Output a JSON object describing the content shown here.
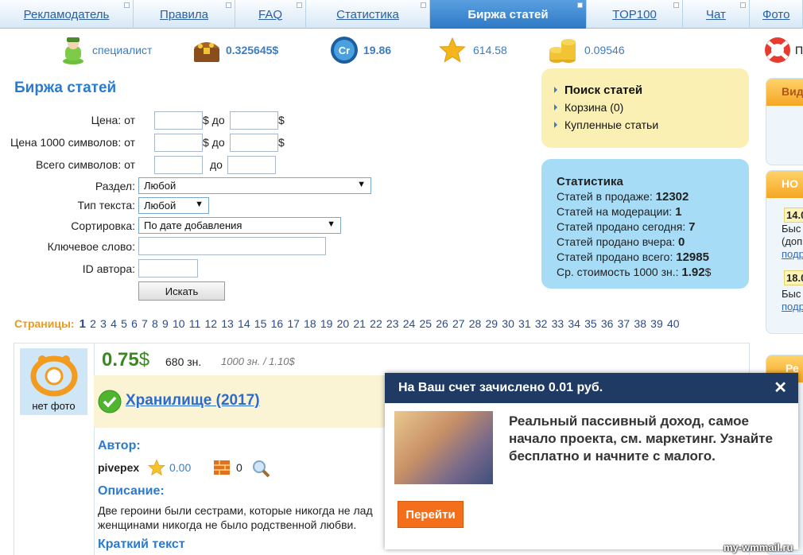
{
  "nav": {
    "items": [
      {
        "label": "Рекламодатель",
        "active": false
      },
      {
        "label": "Правила",
        "active": false
      },
      {
        "label": "FAQ",
        "active": false
      },
      {
        "label": "Статистика",
        "active": false
      },
      {
        "label": "Биржа статей",
        "active": true
      },
      {
        "label": "TOP100",
        "active": false
      },
      {
        "label": "Чат",
        "active": false
      },
      {
        "label": "Фото",
        "active": false
      }
    ]
  },
  "stats": {
    "role": "специалист",
    "balance": "0.325645$",
    "cr": "19.86",
    "cr_badge": "Cr",
    "rating": "614.58",
    "coins": "0.09546",
    "help": "П"
  },
  "page_title": "Биржа статей",
  "form": {
    "price_label": "Цена:",
    "price1000_label": "Цена 1000 символов:",
    "chars_label": "Всего символов:",
    "section_label": "Раздел:",
    "type_label": "Тип текста:",
    "sort_label": "Сортировка:",
    "keyword_label": "Ключевое слово:",
    "author_id_label": "ID автора:",
    "from": "от",
    "to_dollar": "$ до",
    "to": "до",
    "dollar": "$",
    "section_value": "Любой",
    "type_value": "Любой",
    "sort_value": "По дате добавления",
    "search_button": "Искать"
  },
  "menu": {
    "items": [
      {
        "label": "Поиск статей",
        "active": true
      },
      {
        "label": "Корзина (0)",
        "active": false
      },
      {
        "label": "Купленные статьи",
        "active": false
      }
    ]
  },
  "statistics": {
    "title": "Статистика",
    "rows": [
      {
        "label": "Статей в продаже:",
        "value": "12302",
        "suffix": ""
      },
      {
        "label": "Статей на модерации:",
        "value": "1",
        "suffix": ""
      },
      {
        "label": "Статей продано сегодня:",
        "value": "7",
        "suffix": ""
      },
      {
        "label": "Статей продано вчера:",
        "value": "0",
        "suffix": ""
      },
      {
        "label": "Статей продано всего:",
        "value": "12985",
        "suffix": ""
      },
      {
        "label": "Ср. стоимость 1000 зн.:",
        "value": "1.92",
        "suffix": "$"
      }
    ]
  },
  "pages": {
    "label": "Страницы:",
    "list": [
      "1",
      "2",
      "3",
      "4",
      "5",
      "6",
      "7",
      "8",
      "9",
      "10",
      "11",
      "12",
      "13",
      "14",
      "15",
      "16",
      "17",
      "18",
      "19",
      "20",
      "21",
      "22",
      "23",
      "24",
      "25",
      "26",
      "27",
      "28",
      "29",
      "30",
      "31",
      "32",
      "33",
      "34",
      "35",
      "36",
      "37",
      "38",
      "39",
      "40"
    ]
  },
  "article": {
    "no_photo": "нет фото",
    "price": "0.75",
    "price_currency": "$",
    "chars": "680 зн.",
    "per1000": "1000 зн. / 1.10$",
    "title": "Хранилище (2017)",
    "author_heading": "Автор:",
    "author_name": "pivepex",
    "author_rating": "0.00",
    "author_count": "0",
    "desc_heading": "Описание:",
    "desc_line1": "Две героини были сестрами, которые никогда не лад",
    "desc_line2": "женщинами никогда не было родственной любви.",
    "short_heading": "Краткий текст"
  },
  "sidebar": {
    "tab1": "Вид",
    "tab2": "НО",
    "date1": "14.0",
    "text1a": "Быс",
    "text1b": "(доп",
    "link1": "подр",
    "date2": "18.0",
    "text2a": "Быс",
    "link2": "подр",
    "tab3": "Ре"
  },
  "popup": {
    "header": "На Ваш счет зачислено 0.01 руб.",
    "close": "✕",
    "text": "Реальный пассивный доход, самое начало проекта, см. маркетинг. Узнайте бесплатно и начните с малого.",
    "button": "Перейти"
  },
  "watermark": "my-wmmail.ru"
}
